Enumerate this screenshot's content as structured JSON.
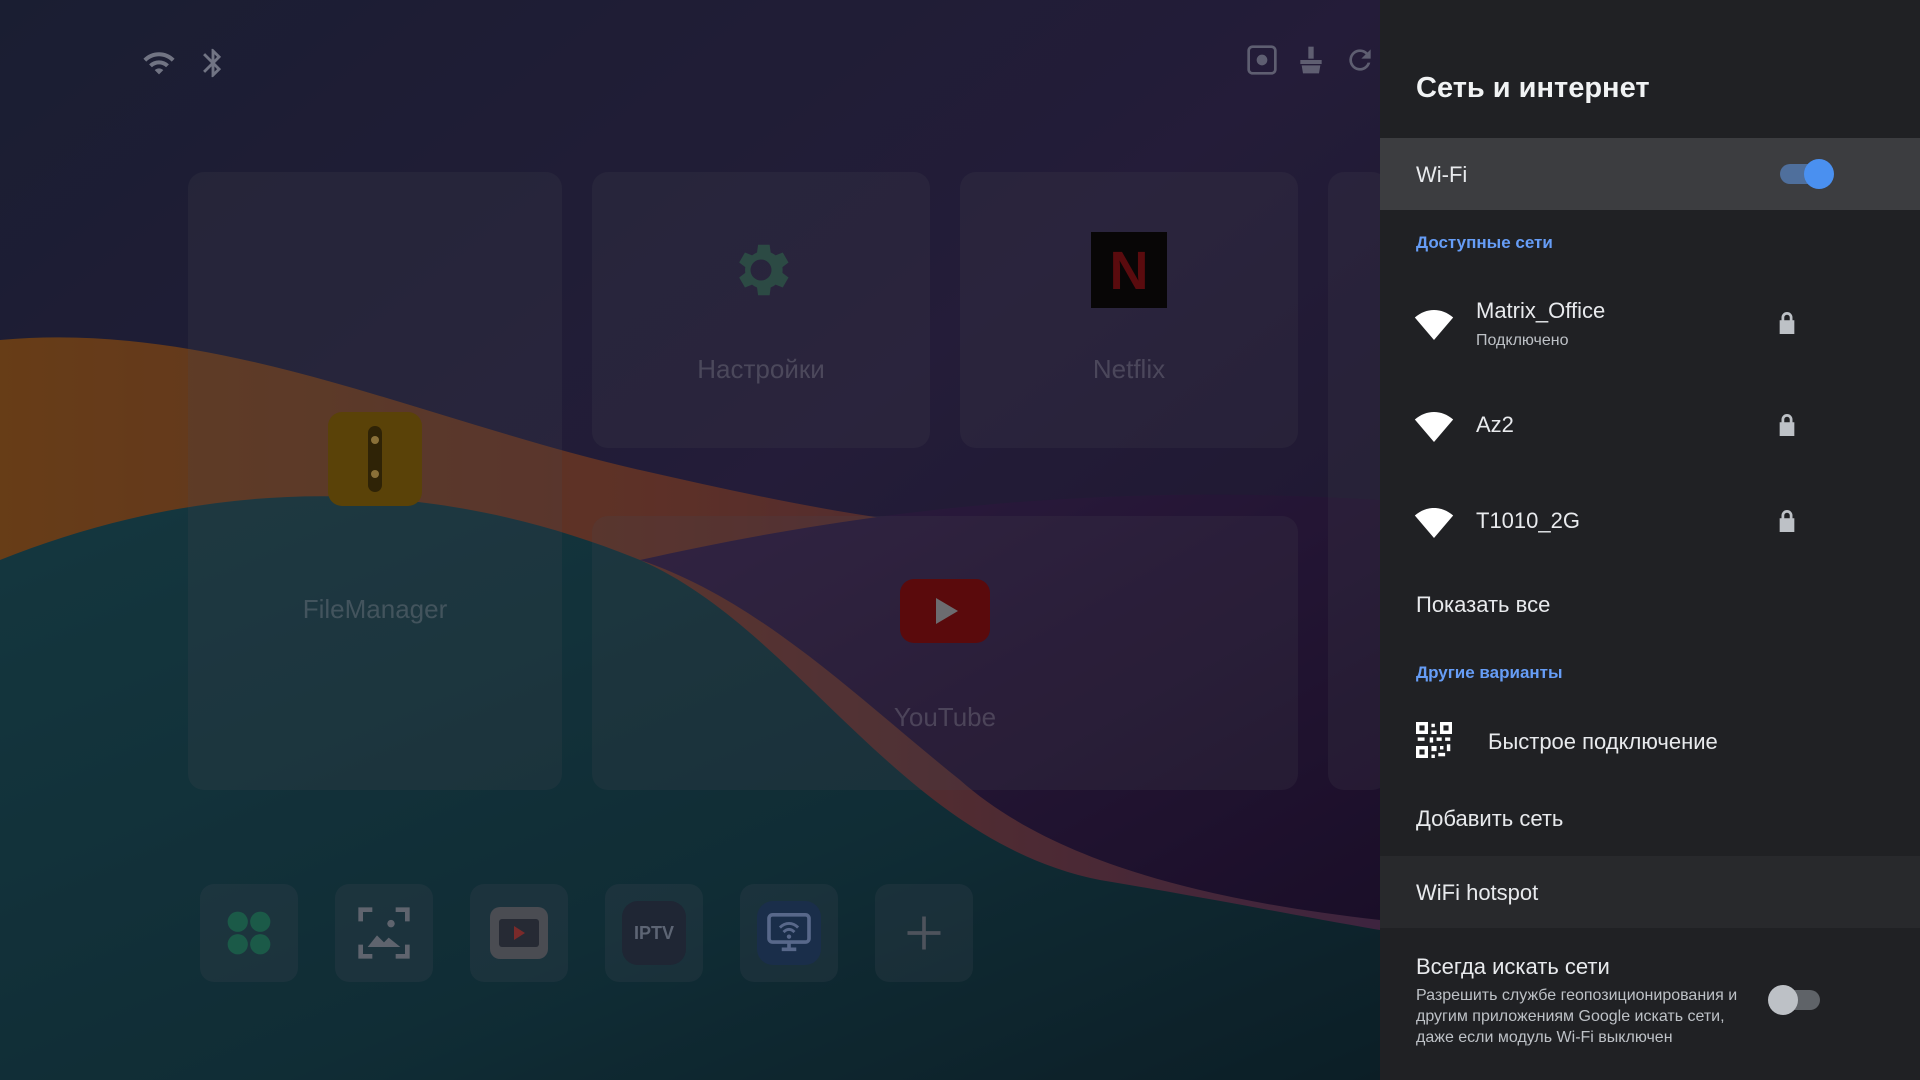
{
  "launcher": {
    "status_icons": [
      "wifi-icon",
      "bluetooth-icon"
    ],
    "top_tools": [
      "screenshot-icon",
      "cleaner-icon",
      "refresh-icon"
    ],
    "tiles": [
      {
        "label": "FileManager",
        "icon": "file-manager-icon"
      },
      {
        "label": "Настройки",
        "icon": "gear-icon"
      },
      {
        "label": "Netflix",
        "icon": "netflix-icon"
      },
      {
        "label": "YouTube",
        "icon": "youtube-icon"
      }
    ],
    "dock": [
      {
        "name": "apps-icon"
      },
      {
        "name": "gallery-icon"
      },
      {
        "name": "media-player-icon"
      },
      {
        "name": "iptv-icon",
        "text": "IPTV"
      },
      {
        "name": "screen-cast-icon"
      },
      {
        "name": "add-icon"
      }
    ]
  },
  "panel": {
    "title": "Сеть и интернет",
    "wifi": {
      "label": "Wi-Fi",
      "enabled": true
    },
    "available_header": "Доступные сети",
    "networks": [
      {
        "name": "Matrix_Office",
        "status": "Подключено",
        "secured": true
      },
      {
        "name": "Az2",
        "status": "",
        "secured": true
      },
      {
        "name": "T1010_2G",
        "status": "",
        "secured": true
      }
    ],
    "show_all": "Показать все",
    "other_header": "Другие варианты",
    "quick_connect": "Быстрое подключение",
    "add_network": "Добавить сеть",
    "hotspot": "WiFi hotspot",
    "always_scan": {
      "label": "Всегда искать сети",
      "description": "Разрешить службе геопозиционирования и другим приложениям Google искать сети, даже если модуль Wi-Fi выключен",
      "enabled": false
    }
  },
  "colors": {
    "accent": "#669df6",
    "toggle_on_knob": "#4a90f0",
    "toggle_on_track": "#4f6f9c",
    "panel_bg": "#202124"
  }
}
